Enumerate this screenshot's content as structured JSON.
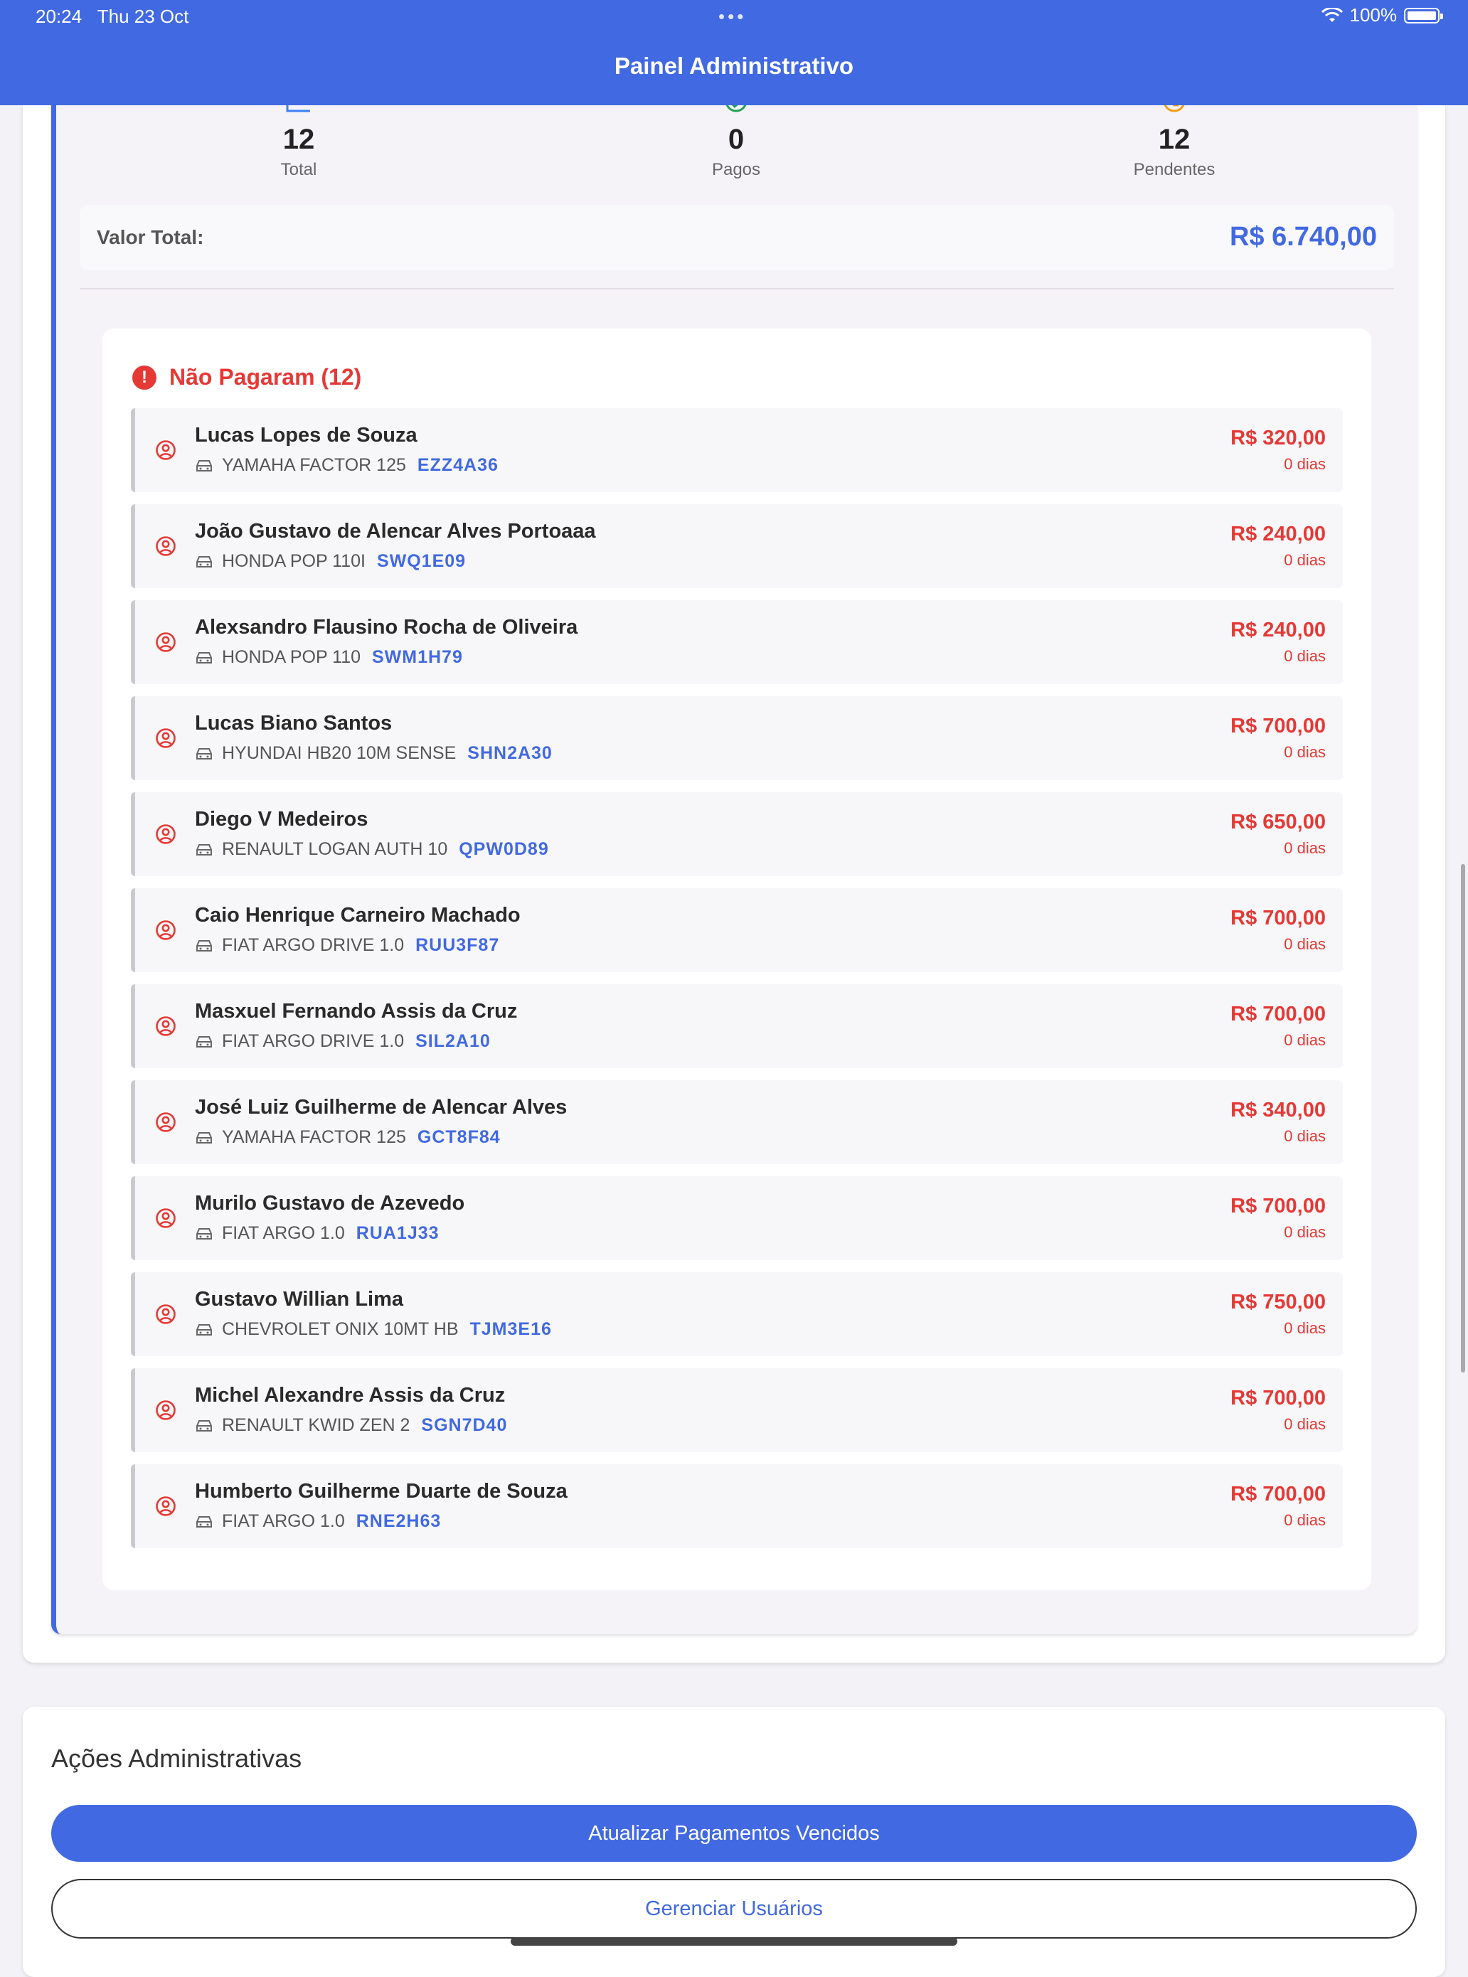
{
  "status_bar": {
    "time": "20:24",
    "date": "Thu 23 Oct",
    "battery": "100%"
  },
  "nav": {
    "title": "Painel Administrativo"
  },
  "stats": [
    {
      "value": "12",
      "label": "Total",
      "icon": "calendar-icon",
      "color": "#3b82f6"
    },
    {
      "value": "0",
      "label": "Pagos",
      "icon": "check-circle-icon",
      "color": "#22a355"
    },
    {
      "value": "12",
      "label": "Pendentes",
      "icon": "clock-icon",
      "color": "#f59e0b"
    }
  ],
  "total": {
    "label": "Valor Total:",
    "value": "R$ 6.740,00"
  },
  "unpaid": {
    "title": "Não Pagaram (12)",
    "rows": [
      {
        "name": "Lucas Lopes de Souza",
        "vehicle": "YAMAHA FACTOR 125",
        "plate": "EZZ4A36",
        "amount": "R$ 320,00",
        "days": "0 dias"
      },
      {
        "name": "João Gustavo de Alencar Alves Portoaaa",
        "vehicle": "HONDA POP 110I",
        "plate": "SWQ1E09",
        "amount": "R$ 240,00",
        "days": "0 dias"
      },
      {
        "name": "Alexsandro Flausino Rocha de Oliveira",
        "vehicle": "HONDA POP 110",
        "plate": "SWM1H79",
        "amount": "R$ 240,00",
        "days": "0 dias"
      },
      {
        "name": "Lucas Biano Santos",
        "vehicle": "HYUNDAI HB20 10M SENSE",
        "plate": "SHN2A30",
        "amount": "R$ 700,00",
        "days": "0 dias"
      },
      {
        "name": "Diego V Medeiros",
        "vehicle": "RENAULT LOGAN AUTH 10",
        "plate": "QPW0D89",
        "amount": "R$ 650,00",
        "days": "0 dias"
      },
      {
        "name": "Caio Henrique Carneiro Machado",
        "vehicle": "FIAT ARGO DRIVE 1.0",
        "plate": "RUU3F87",
        "amount": "R$ 700,00",
        "days": "0 dias"
      },
      {
        "name": "Masxuel Fernando Assis da Cruz",
        "vehicle": "FIAT ARGO DRIVE 1.0",
        "plate": "SIL2A10",
        "amount": "R$ 700,00",
        "days": "0 dias"
      },
      {
        "name": "José Luiz Guilherme de Alencar Alves",
        "vehicle": "YAMAHA FACTOR 125",
        "plate": "GCT8F84",
        "amount": "R$ 340,00",
        "days": "0 dias"
      },
      {
        "name": "Murilo Gustavo de Azevedo",
        "vehicle": "FIAT ARGO 1.0",
        "plate": "RUA1J33",
        "amount": "R$ 700,00",
        "days": "0 dias"
      },
      {
        "name": "Gustavo Willian Lima",
        "vehicle": "CHEVROLET ONIX 10MT HB",
        "plate": "TJM3E16",
        "amount": "R$ 750,00",
        "days": "0 dias"
      },
      {
        "name": "Michel Alexandre Assis da Cruz",
        "vehicle": "RENAULT KWID ZEN 2",
        "plate": "SGN7D40",
        "amount": "R$ 700,00",
        "days": "0 dias"
      },
      {
        "name": "Humberto Guilherme Duarte de Souza",
        "vehicle": "FIAT ARGO 1.0",
        "plate": "RNE2H63",
        "amount": "R$ 700,00",
        "days": "0 dias"
      }
    ]
  },
  "admin": {
    "title": "Ações Administrativas",
    "update_button": "Atualizar Pagamentos Vencidos",
    "users_button": "Gerenciar Usuários"
  },
  "colors": {
    "accent": "#4169e1",
    "danger": "#e53935"
  }
}
